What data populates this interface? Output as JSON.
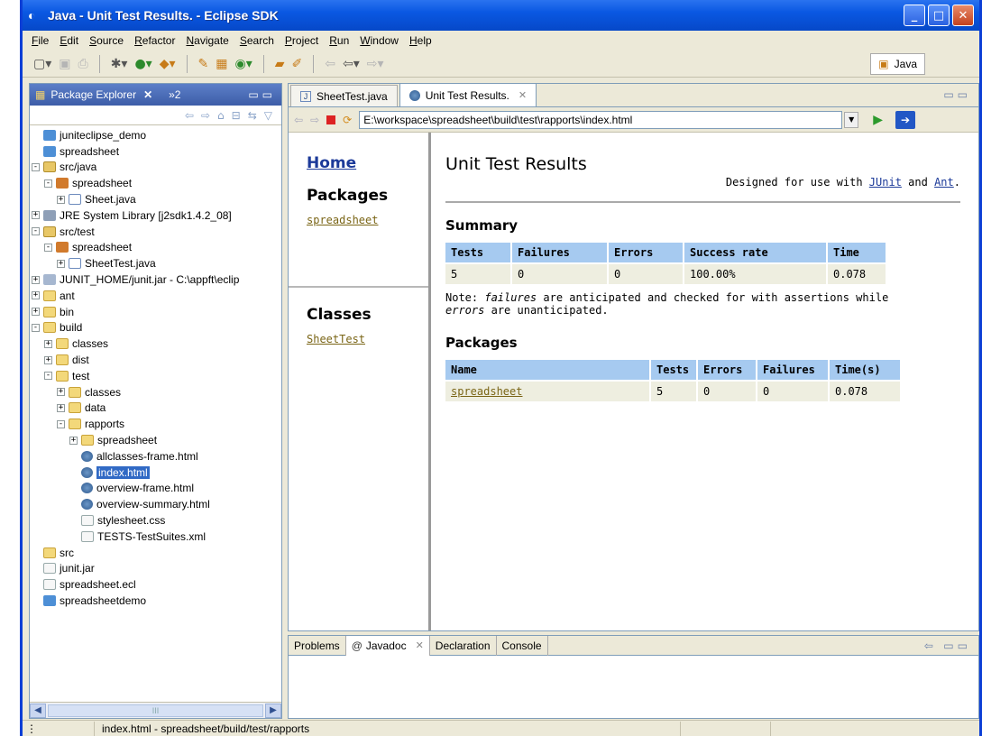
{
  "window": {
    "title": "Java - Unit Test Results. - Eclipse SDK",
    "minimize": "_",
    "maximize": "□",
    "close": "✕"
  },
  "menu": [
    "File",
    "Edit",
    "Source",
    "Refactor",
    "Navigate",
    "Search",
    "Project",
    "Run",
    "Window",
    "Help"
  ],
  "perspective": {
    "label": "Java"
  },
  "package_explorer": {
    "tab_label": "Package Explorer",
    "overflow_count": "»2",
    "tree": [
      {
        "label": "juniteclipse_demo",
        "icon": "project-icon",
        "indent": 0,
        "exp": ""
      },
      {
        "label": "spreadsheet",
        "icon": "project-icon",
        "indent": 0,
        "exp": ""
      },
      {
        "label": "src/java",
        "icon": "source-folder-icon",
        "indent": 0,
        "exp": "-"
      },
      {
        "label": "spreadsheet",
        "icon": "package-icon",
        "indent": 1,
        "exp": "-"
      },
      {
        "label": "Sheet.java",
        "icon": "java-file-icon",
        "indent": 2,
        "exp": "+"
      },
      {
        "label": "JRE System Library [j2sdk1.4.2_08]",
        "icon": "library-icon",
        "indent": 0,
        "exp": "+"
      },
      {
        "label": "src/test",
        "icon": "source-folder-icon",
        "indent": 0,
        "exp": "-"
      },
      {
        "label": "spreadsheet",
        "icon": "package-icon",
        "indent": 1,
        "exp": "-"
      },
      {
        "label": "SheetTest.java",
        "icon": "java-file-icon",
        "indent": 2,
        "exp": "+"
      },
      {
        "label": "JUNIT_HOME/junit.jar - C:\\appft\\eclip",
        "icon": "jar-icon",
        "indent": 0,
        "exp": "+"
      },
      {
        "label": "ant",
        "icon": "folder-icon",
        "indent": 0,
        "exp": "+"
      },
      {
        "label": "bin",
        "icon": "folder-icon",
        "indent": 0,
        "exp": "+"
      },
      {
        "label": "build",
        "icon": "folder-icon",
        "indent": 0,
        "exp": "-"
      },
      {
        "label": "classes",
        "icon": "folder-icon",
        "indent": 1,
        "exp": "+"
      },
      {
        "label": "dist",
        "icon": "folder-icon",
        "indent": 1,
        "exp": "+"
      },
      {
        "label": "test",
        "icon": "folder-icon",
        "indent": 1,
        "exp": "-"
      },
      {
        "label": "classes",
        "icon": "folder-icon",
        "indent": 2,
        "exp": "+"
      },
      {
        "label": "data",
        "icon": "folder-icon",
        "indent": 2,
        "exp": "+"
      },
      {
        "label": "rapports",
        "icon": "folder-icon",
        "indent": 2,
        "exp": "-"
      },
      {
        "label": "spreadsheet",
        "icon": "folder-icon",
        "indent": 3,
        "exp": "+"
      },
      {
        "label": "allclasses-frame.html",
        "icon": "html-file-icon",
        "indent": 3,
        "exp": ""
      },
      {
        "label": "index.html",
        "icon": "html-file-icon",
        "indent": 3,
        "exp": "",
        "selected": true
      },
      {
        "label": "overview-frame.html",
        "icon": "html-file-icon",
        "indent": 3,
        "exp": ""
      },
      {
        "label": "overview-summary.html",
        "icon": "html-file-icon",
        "indent": 3,
        "exp": ""
      },
      {
        "label": "stylesheet.css",
        "icon": "text-file-icon",
        "indent": 3,
        "exp": ""
      },
      {
        "label": "TESTS-TestSuites.xml",
        "icon": "text-file-icon",
        "indent": 3,
        "exp": ""
      },
      {
        "label": "src",
        "icon": "folder-icon",
        "indent": 0,
        "exp": ""
      },
      {
        "label": "junit.jar",
        "icon": "text-file-icon",
        "indent": 0,
        "exp": ""
      },
      {
        "label": "spreadsheet.ecl",
        "icon": "text-file-icon",
        "indent": 0,
        "exp": ""
      },
      {
        "label": "spreadsheetdemo",
        "icon": "project-icon",
        "indent": -1,
        "exp": ""
      }
    ],
    "scroll_thumb": "III"
  },
  "editor": {
    "tabs": [
      {
        "label": "SheetTest.java",
        "active": false
      },
      {
        "label": "Unit Test Results.",
        "active": true
      }
    ],
    "url": "E:\\workspace\\spreadsheet\\build\\test\\rapports\\index.html"
  },
  "report_nav": {
    "home": "Home",
    "packages_heading": "Packages",
    "package_link": "spreadsheet",
    "classes_heading": "Classes",
    "class_link": "SheetTest"
  },
  "report": {
    "title": "Unit Test Results",
    "designed_prefix": "Designed for use with",
    "junit": "JUnit",
    "and": "and",
    "ant": "Ant",
    "period": ".",
    "summary_heading": "Summary",
    "summary_headers": [
      "Tests",
      "Failures",
      "Errors",
      "Success rate",
      "Time"
    ],
    "summary_values": [
      "5",
      "0",
      "0",
      "100.00%",
      "0.078"
    ],
    "note_prefix": "Note:",
    "note_failures": "failures",
    "note_mid": "are anticipated and checked for with assertions while",
    "note_errors": "errors",
    "note_end": "are unanticipated.",
    "packages_heading": "Packages",
    "packages_headers": [
      "Name",
      "Tests",
      "Errors",
      "Failures",
      "Time(s)"
    ],
    "packages_rows": [
      [
        "spreadsheet",
        "5",
        "0",
        "0",
        "0.078"
      ]
    ]
  },
  "bottom_view": {
    "tabs": [
      "Problems",
      "Javadoc",
      "Declaration",
      "Console"
    ],
    "javadoc_prefix": "@"
  },
  "status": {
    "message": "index.html - spreadsheet/build/test/rapports"
  }
}
